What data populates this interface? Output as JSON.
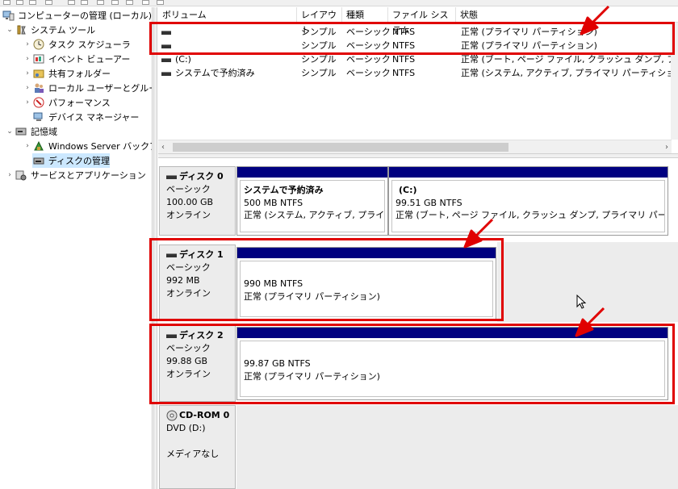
{
  "tree": {
    "items": [
      {
        "label": "コンピューターの管理 (ローカル)",
        "icon": "computer-management-icon",
        "expander": ""
      },
      {
        "label": "システム ツール",
        "icon": "system-tools-icon",
        "expander": "⌄"
      },
      {
        "label": "タスク スケジューラ",
        "icon": "clock-icon",
        "expander": "›"
      },
      {
        "label": "イベント ビューアー",
        "icon": "event-viewer-icon",
        "expander": "›"
      },
      {
        "label": "共有フォルダー",
        "icon": "shared-folder-icon",
        "expander": "›"
      },
      {
        "label": "ローカル ユーザーとグループ",
        "icon": "users-icon",
        "expander": "›"
      },
      {
        "label": "パフォーマンス",
        "icon": "performance-icon",
        "expander": "›"
      },
      {
        "label": "デバイス マネージャー",
        "icon": "device-manager-icon",
        "expander": ""
      },
      {
        "label": "記憶域",
        "icon": "storage-icon",
        "expander": "⌄"
      },
      {
        "label": "Windows Server バックア",
        "icon": "backup-icon",
        "expander": "›"
      },
      {
        "label": "ディスクの管理",
        "icon": "disk-management-icon",
        "expander": ""
      },
      {
        "label": "サービスとアプリケーション",
        "icon": "services-icon",
        "expander": "›"
      }
    ]
  },
  "volume_list": {
    "columns": [
      "ボリューム",
      "レイアウト",
      "種類",
      "ファイル システム",
      "状態"
    ],
    "rows": [
      {
        "volume": "",
        "layout": "シンプル",
        "type": "ベーシック",
        "fs": "NTFS",
        "status": "正常 (プライマリ パーティション)"
      },
      {
        "volume": "",
        "layout": "シンプル",
        "type": "ベーシック",
        "fs": "NTFS",
        "status": "正常 (プライマリ パーティション)"
      },
      {
        "volume": "(C:)",
        "layout": "シンプル",
        "type": "ベーシック",
        "fs": "NTFS",
        "status": "正常 (ブート, ページ ファイル, クラッシュ ダンプ, プライマリ"
      },
      {
        "volume": "システムで予約済み",
        "layout": "シンプル",
        "type": "ベーシック",
        "fs": "NTFS",
        "status": "正常 (システム, アクティブ, プライマリ パーティション)"
      }
    ]
  },
  "disks": [
    {
      "name": "ディスク 0",
      "kind": "ベーシック",
      "size": "100.00 GB",
      "state": "オンライン",
      "partitions": [
        {
          "title": "システムで予約済み",
          "size": "500 MB NTFS",
          "status": "正常 (システム, アクティブ, プライマリ パ"
        },
        {
          "title": "(C:)",
          "size": "99.51 GB NTFS",
          "status": "正常 (ブート, ページ ファイル, クラッシュ ダンプ, プライマリ パーティション)"
        }
      ]
    },
    {
      "name": "ディスク 1",
      "kind": "ベーシック",
      "size": "992 MB",
      "state": "オンライン",
      "partitions": [
        {
          "title": "",
          "size": "990 MB NTFS",
          "status": "正常 (プライマリ パーティション)"
        }
      ]
    },
    {
      "name": "ディスク 2",
      "kind": "ベーシック",
      "size": "99.88 GB",
      "state": "オンライン",
      "partitions": [
        {
          "title": "",
          "size": "99.87 GB NTFS",
          "status": "正常 (プライマリ パーティション)"
        }
      ]
    },
    {
      "name": "CD-ROM 0",
      "kind": "DVD (D:)",
      "size": "",
      "state": "メディアなし",
      "partitions": []
    }
  ],
  "colors": {
    "partition_bar": "#000080",
    "highlight": "#e00000",
    "selection": "#cce8ff"
  }
}
